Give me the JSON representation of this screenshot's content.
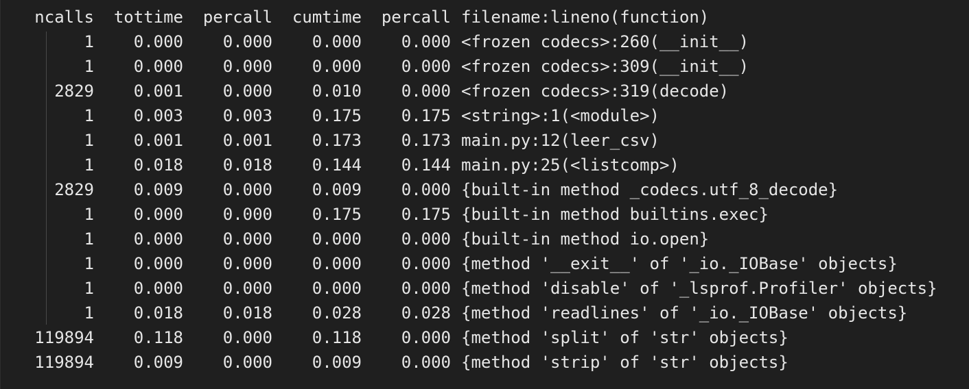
{
  "headers": {
    "ncalls": "ncalls",
    "tottime": "tottime",
    "percall": "percall",
    "cumtime": "cumtime",
    "percall2": "percall",
    "function": "filename:lineno(function)"
  },
  "rows": [
    {
      "ncalls": "1",
      "tottime": "0.000",
      "percall": "0.000",
      "cumtime": "0.000",
      "percall2": "0.000",
      "function": "<frozen codecs>:260(__init__)"
    },
    {
      "ncalls": "1",
      "tottime": "0.000",
      "percall": "0.000",
      "cumtime": "0.000",
      "percall2": "0.000",
      "function": "<frozen codecs>:309(__init__)"
    },
    {
      "ncalls": "2829",
      "tottime": "0.001",
      "percall": "0.000",
      "cumtime": "0.010",
      "percall2": "0.000",
      "function": "<frozen codecs>:319(decode)"
    },
    {
      "ncalls": "1",
      "tottime": "0.003",
      "percall": "0.003",
      "cumtime": "0.175",
      "percall2": "0.175",
      "function": "<string>:1(<module>)"
    },
    {
      "ncalls": "1",
      "tottime": "0.001",
      "percall": "0.001",
      "cumtime": "0.173",
      "percall2": "0.173",
      "function": "main.py:12(leer_csv)"
    },
    {
      "ncalls": "1",
      "tottime": "0.018",
      "percall": "0.018",
      "cumtime": "0.144",
      "percall2": "0.144",
      "function": "main.py:25(<listcomp>)"
    },
    {
      "ncalls": "2829",
      "tottime": "0.009",
      "percall": "0.000",
      "cumtime": "0.009",
      "percall2": "0.000",
      "function": "{built-in method _codecs.utf_8_decode}"
    },
    {
      "ncalls": "1",
      "tottime": "0.000",
      "percall": "0.000",
      "cumtime": "0.175",
      "percall2": "0.175",
      "function": "{built-in method builtins.exec}"
    },
    {
      "ncalls": "1",
      "tottime": "0.000",
      "percall": "0.000",
      "cumtime": "0.000",
      "percall2": "0.000",
      "function": "{built-in method io.open}"
    },
    {
      "ncalls": "1",
      "tottime": "0.000",
      "percall": "0.000",
      "cumtime": "0.000",
      "percall2": "0.000",
      "function": "{method '__exit__' of '_io._IOBase' objects}"
    },
    {
      "ncalls": "1",
      "tottime": "0.000",
      "percall": "0.000",
      "cumtime": "0.000",
      "percall2": "0.000",
      "function": "{method 'disable' of '_lsprof.Profiler' objects}"
    },
    {
      "ncalls": "1",
      "tottime": "0.018",
      "percall": "0.018",
      "cumtime": "0.028",
      "percall2": "0.028",
      "function": "{method 'readlines' of '_io._IOBase' objects}"
    },
    {
      "ncalls": "119894",
      "tottime": "0.118",
      "percall": "0.000",
      "cumtime": "0.118",
      "percall2": "0.000",
      "function": "{method 'split' of 'str' objects}"
    },
    {
      "ncalls": "119894",
      "tottime": "0.009",
      "percall": "0.000",
      "cumtime": "0.009",
      "percall2": "0.000",
      "function": "{method 'strip' of 'str' objects}"
    }
  ]
}
